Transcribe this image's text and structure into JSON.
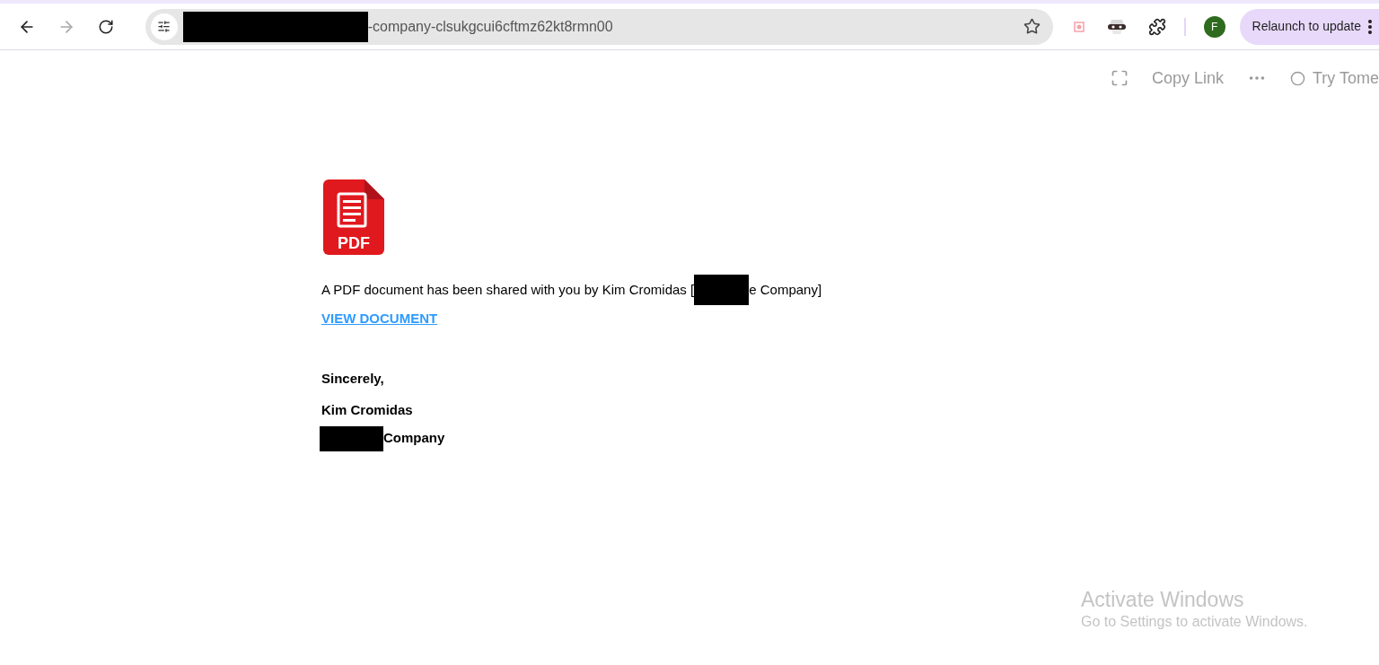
{
  "browser": {
    "nav_buttons": [
      {
        "kind": "back",
        "disabled": false
      },
      {
        "kind": "forward",
        "disabled": true
      },
      {
        "kind": "reload",
        "disabled": false
      }
    ],
    "address": {
      "url_tail": "-company-clsukgcui6cftmz62kt8rmn00"
    },
    "avatar": {
      "initial": "F"
    },
    "relaunch": {
      "label": "Relaunch to update"
    }
  },
  "doc_toolbar": {
    "copy_link": "Copy Link",
    "try": "Try Tome"
  },
  "message": {
    "pdf_label": "PDF",
    "sentence_start": "A PDF document has been shared with you by Kim Cromidas  [",
    "sentence_end": "e Company]",
    "link": "VIEW DOCUMENT",
    "closing": "Sincerely,",
    "sender": "Kim Cromidas",
    "company": "Company"
  },
  "os_notice": {
    "title": "Activate Windows",
    "subtitle": "Go to Settings to activate Windows."
  }
}
